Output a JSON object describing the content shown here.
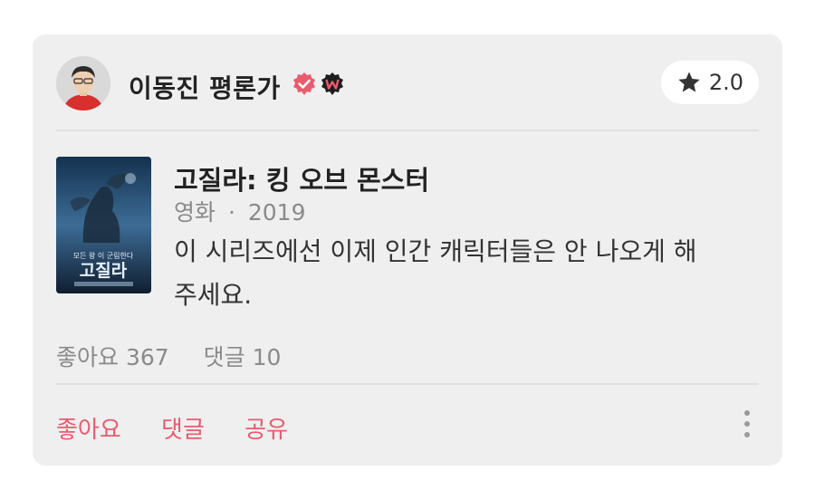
{
  "header": {
    "reviewer_name": "이동진 평론가",
    "badges": [
      "verified-badge",
      "watcha-w-badge"
    ],
    "rating": "2.0",
    "rating_icon": "star-icon"
  },
  "movie": {
    "title": "고질라: 킹 오브 몬스터",
    "category": "영화",
    "separator": "·",
    "year": "2019",
    "poster_text": "고질라"
  },
  "review": {
    "text": "이 시리즈에선 이제 인간 캐릭터들은 안 나오게 해주세요."
  },
  "stats": {
    "likes": "좋아요 367",
    "comments": "댓글 10"
  },
  "actions": {
    "like": "좋아요",
    "comment": "댓글",
    "share": "공유",
    "more_icon": "more-vertical-icon"
  },
  "colors": {
    "accent": "#ea5b6e",
    "card_bg": "#efefef",
    "muted_text": "#8a8a8a"
  }
}
